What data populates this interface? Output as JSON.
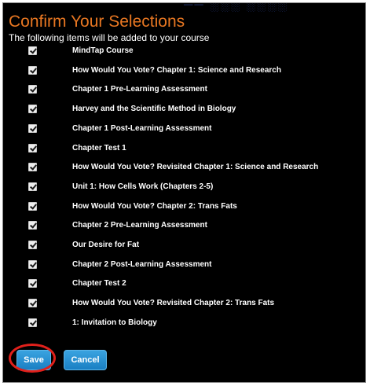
{
  "dialog": {
    "title": "Confirm Your Selections",
    "subtitle": "The following items will be added to your course"
  },
  "items": [
    {
      "label": "MindTap Course",
      "checked": true
    },
    {
      "label": "How Would You Vote? Chapter 1: Science and Research",
      "checked": true
    },
    {
      "label": "Chapter 1 Pre-Learning Assessment",
      "checked": true
    },
    {
      "label": "Harvey and the Scientific Method in Biology",
      "checked": true
    },
    {
      "label": "Chapter 1 Post-Learning Assessment",
      "checked": true
    },
    {
      "label": "Chapter Test 1",
      "checked": true
    },
    {
      "label": "How Would You Vote? Revisited Chapter 1: Science and Research",
      "checked": true
    },
    {
      "label": "Unit 1: How Cells Work (Chapters 2-5)",
      "checked": true
    },
    {
      "label": "How Would You Vote? Chapter 2: Trans Fats",
      "checked": true
    },
    {
      "label": "Chapter 2 Pre-Learning Assessment",
      "checked": true
    },
    {
      "label": "Our Desire for Fat",
      "checked": true
    },
    {
      "label": "Chapter 2 Post-Learning Assessment",
      "checked": true
    },
    {
      "label": "Chapter Test 2",
      "checked": true
    },
    {
      "label": "How Would You Vote? Revisited Chapter 2: Trans Fats",
      "checked": true
    },
    {
      "label": "1: Invitation to Biology",
      "checked": true
    }
  ],
  "buttons": {
    "save_label": "Save",
    "cancel_label": "Cancel"
  },
  "colors": {
    "title": "#e87722",
    "background": "#000000",
    "button": "#2b93d6",
    "highlight": "#e0201b"
  }
}
